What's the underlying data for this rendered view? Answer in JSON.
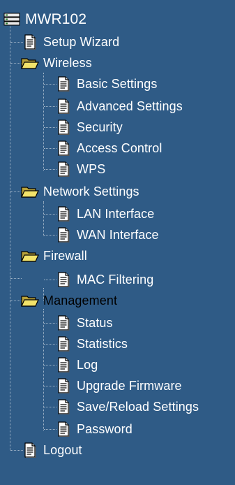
{
  "colors": {
    "background": "#2f5b86",
    "text": "#ffffff",
    "selected_text": "#000000",
    "connector": "#9fb3c7"
  },
  "tree": {
    "root": {
      "label": "MWR102",
      "icon": "router-icon"
    },
    "setup_wizard": {
      "label": "Setup Wizard",
      "icon": "document-icon"
    },
    "wireless": {
      "label": "Wireless",
      "icon": "open-folder-icon",
      "items": [
        {
          "label": "Basic Settings",
          "icon": "document-icon"
        },
        {
          "label": "Advanced Settings",
          "icon": "document-icon"
        },
        {
          "label": "Security",
          "icon": "document-icon"
        },
        {
          "label": "Access Control",
          "icon": "document-icon"
        },
        {
          "label": "WPS",
          "icon": "document-icon"
        }
      ]
    },
    "network": {
      "label": "Network Settings",
      "icon": "open-folder-icon",
      "items": [
        {
          "label": "LAN Interface",
          "icon": "document-icon"
        },
        {
          "label": "WAN Interface",
          "icon": "document-icon"
        }
      ]
    },
    "firewall": {
      "label": "Firewall",
      "icon": "open-folder-icon",
      "items": [
        {
          "label": "MAC Filtering",
          "icon": "document-icon"
        }
      ]
    },
    "management": {
      "label": "Management",
      "icon": "open-folder-icon",
      "selected": true,
      "items": [
        {
          "label": "Status",
          "icon": "document-icon"
        },
        {
          "label": "Statistics",
          "icon": "document-icon"
        },
        {
          "label": "Log",
          "icon": "document-icon"
        },
        {
          "label": "Upgrade Firmware",
          "icon": "document-icon"
        },
        {
          "label": "Save/Reload Settings",
          "icon": "document-icon"
        },
        {
          "label": "Password",
          "icon": "document-icon"
        }
      ]
    },
    "logout": {
      "label": "Logout",
      "icon": "document-icon"
    }
  }
}
